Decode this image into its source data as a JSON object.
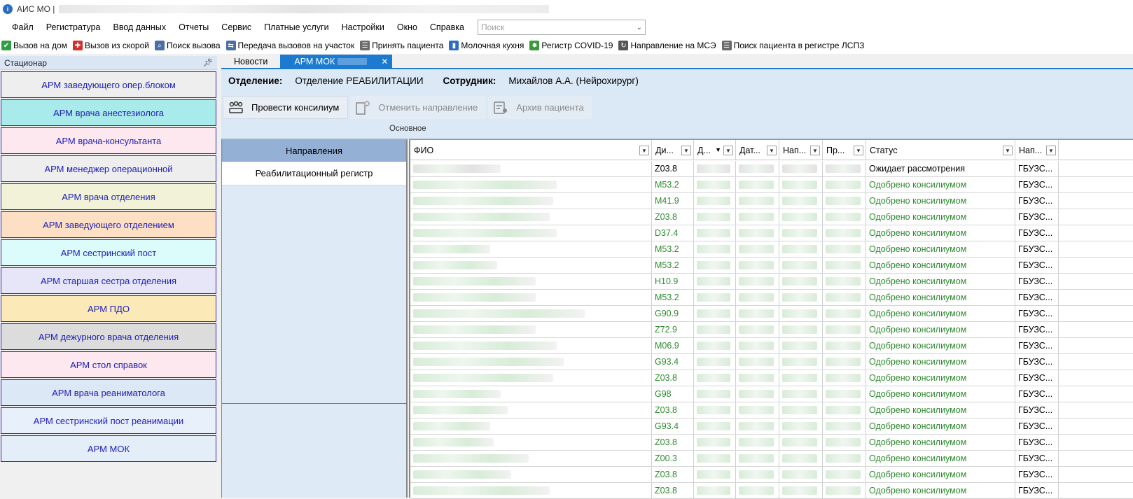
{
  "window": {
    "title": "АИС МО |"
  },
  "menu": [
    "Файл",
    "Регистратура",
    "Ввод данных",
    "Отчеты",
    "Сервис",
    "Платные услуги",
    "Настройки",
    "Окно",
    "Справка"
  ],
  "search": {
    "placeholder": "Поиск"
  },
  "toolbar": [
    {
      "label": "Вызов на дом",
      "icon": "check-icon",
      "color": "#2ea043"
    },
    {
      "label": "Вызов из скорой",
      "icon": "ambulance-icon",
      "color": "#d32f2f"
    },
    {
      "label": "Поиск вызова",
      "icon": "search-icon",
      "color": "#4a6fa5"
    },
    {
      "label": "Передача вызовов на участок",
      "icon": "transfer-icon",
      "color": "#4a6fa5"
    },
    {
      "label": "Принять пациента",
      "icon": "patient-icon",
      "color": "#6a6a6a"
    },
    {
      "label": "Молочная кухня",
      "icon": "bottle-icon",
      "color": "#2b6cc4"
    },
    {
      "label": "Регистр COVID-19",
      "icon": "virus-icon",
      "color": "#3a9a3a"
    },
    {
      "label": "Направление на МСЭ",
      "icon": "referral-icon",
      "color": "#555"
    },
    {
      "label": "Поиск пациента в регистре ЛСПЗ",
      "icon": "patient-search-icon",
      "color": "#6a6a6a"
    }
  ],
  "left_panel": {
    "header": "Стационар",
    "items": [
      {
        "label": "АРМ заведующего опер.блоком",
        "bg": "#eeeeee"
      },
      {
        "label": "АРМ врача анестезиолога",
        "bg": "#a8ebea"
      },
      {
        "label": "АРМ врача-консультанта",
        "bg": "#fde8f0"
      },
      {
        "label": "АРМ менеджер  операционной",
        "bg": "#eeeeee"
      },
      {
        "label": "АРМ врача отделения",
        "bg": "#f2f2d8"
      },
      {
        "label": "АРМ заведующего отделением",
        "bg": "#fde0c4"
      },
      {
        "label": "АРМ сестринский пост",
        "bg": "#dcfcfc"
      },
      {
        "label": "АРМ старшая сестра отделения",
        "bg": "#e6e6f8"
      },
      {
        "label": "АРМ ПДО",
        "bg": "#fbeab8"
      },
      {
        "label": "АРМ дежурного врача отделения",
        "bg": "#dcdcdc"
      },
      {
        "label": "АРМ стол справок",
        "bg": "#fde8f0"
      },
      {
        "label": "АРМ врача реаниматолога",
        "bg": "#dde8f6"
      },
      {
        "label": "АРМ сестринский пост реанимации",
        "bg": "#e8f0fb"
      },
      {
        "label": "АРМ МОК",
        "bg": "#e4eef9"
      }
    ]
  },
  "tabs": [
    {
      "label": "Новости"
    },
    {
      "label": "АРМ МОК",
      "close": "✕"
    }
  ],
  "ribbon": {
    "dept_label": "Отделение:",
    "dept_value": "Отделение РЕАБИЛИТАЦИИ",
    "emp_label": "Сотрудник:",
    "emp_value": "Михайлов А.А. (Нейрохирург)",
    "buttons": [
      {
        "label": "Провести консилиум",
        "enabled": true,
        "icon": "council-icon"
      },
      {
        "label": "Отменить направление",
        "enabled": false,
        "icon": "cancel-referral-icon"
      },
      {
        "label": "Архив пациента",
        "enabled": false,
        "icon": "archive-icon"
      }
    ],
    "group": "Основное"
  },
  "nav": {
    "header": "Направления",
    "items": [
      "Реабилитационный регистр"
    ]
  },
  "grid": {
    "columns": [
      {
        "label": "ФИО"
      },
      {
        "label": "Ди..."
      },
      {
        "label": "Д..."
      },
      {
        "label": "Дат..."
      },
      {
        "label": "Нап..."
      },
      {
        "label": "Пр..."
      },
      {
        "label": "Статус"
      },
      {
        "label": "Нап..."
      }
    ],
    "rows": [
      {
        "diag": "Z03.8",
        "status": "Ожидает рассмотрения",
        "org": "ГБУЗС..."
      },
      {
        "diag": "M53.2",
        "status": "Одобрено консилиумом",
        "org": "ГБУЗС..."
      },
      {
        "diag": "M41.9",
        "status": "Одобрено консилиумом",
        "org": "ГБУЗС..."
      },
      {
        "diag": "Z03.8",
        "status": "Одобрено консилиумом",
        "org": "ГБУЗС..."
      },
      {
        "diag": "D37.4",
        "status": "Одобрено консилиумом",
        "org": "ГБУЗС..."
      },
      {
        "diag": "M53.2",
        "status": "Одобрено консилиумом",
        "org": "ГБУЗС..."
      },
      {
        "diag": "M53.2",
        "status": "Одобрено консилиумом",
        "org": "ГБУЗС..."
      },
      {
        "diag": "H10.9",
        "status": "Одобрено консилиумом",
        "org": "ГБУЗС..."
      },
      {
        "diag": "M53.2",
        "status": "Одобрено консилиумом",
        "org": "ГБУЗС..."
      },
      {
        "diag": "G90.9",
        "status": "Одобрено консилиумом",
        "org": "ГБУЗС..."
      },
      {
        "diag": "Z72.9",
        "status": "Одобрено консилиумом",
        "org": "ГБУЗС..."
      },
      {
        "diag": "M06.9",
        "status": "Одобрено консилиумом",
        "org": "ГБУЗС..."
      },
      {
        "diag": "G93.4",
        "status": "Одобрено консилиумом",
        "org": "ГБУЗС..."
      },
      {
        "diag": "Z03.8",
        "status": "Одобрено консилиумом",
        "org": "ГБУЗС..."
      },
      {
        "diag": "G98",
        "status": "Одобрено консилиумом",
        "org": "ГБУЗС..."
      },
      {
        "diag": "Z03.8",
        "status": "Одобрено консилиумом",
        "org": "ГБУЗС..."
      },
      {
        "diag": "G93.4",
        "status": "Одобрено консилиумом",
        "org": "ГБУЗС..."
      },
      {
        "diag": "Z03.8",
        "status": "Одобрено консилиумом",
        "org": "ГБУЗС..."
      },
      {
        "diag": "Z00.3",
        "status": "Одобрено консилиумом",
        "org": "ГБУЗС..."
      },
      {
        "diag": "Z03.8",
        "status": "Одобрено консилиумом",
        "org": "ГБУЗС..."
      },
      {
        "diag": "Z03.8",
        "status": "Одобрено консилиумом",
        "org": "ГБУЗС..."
      }
    ]
  }
}
